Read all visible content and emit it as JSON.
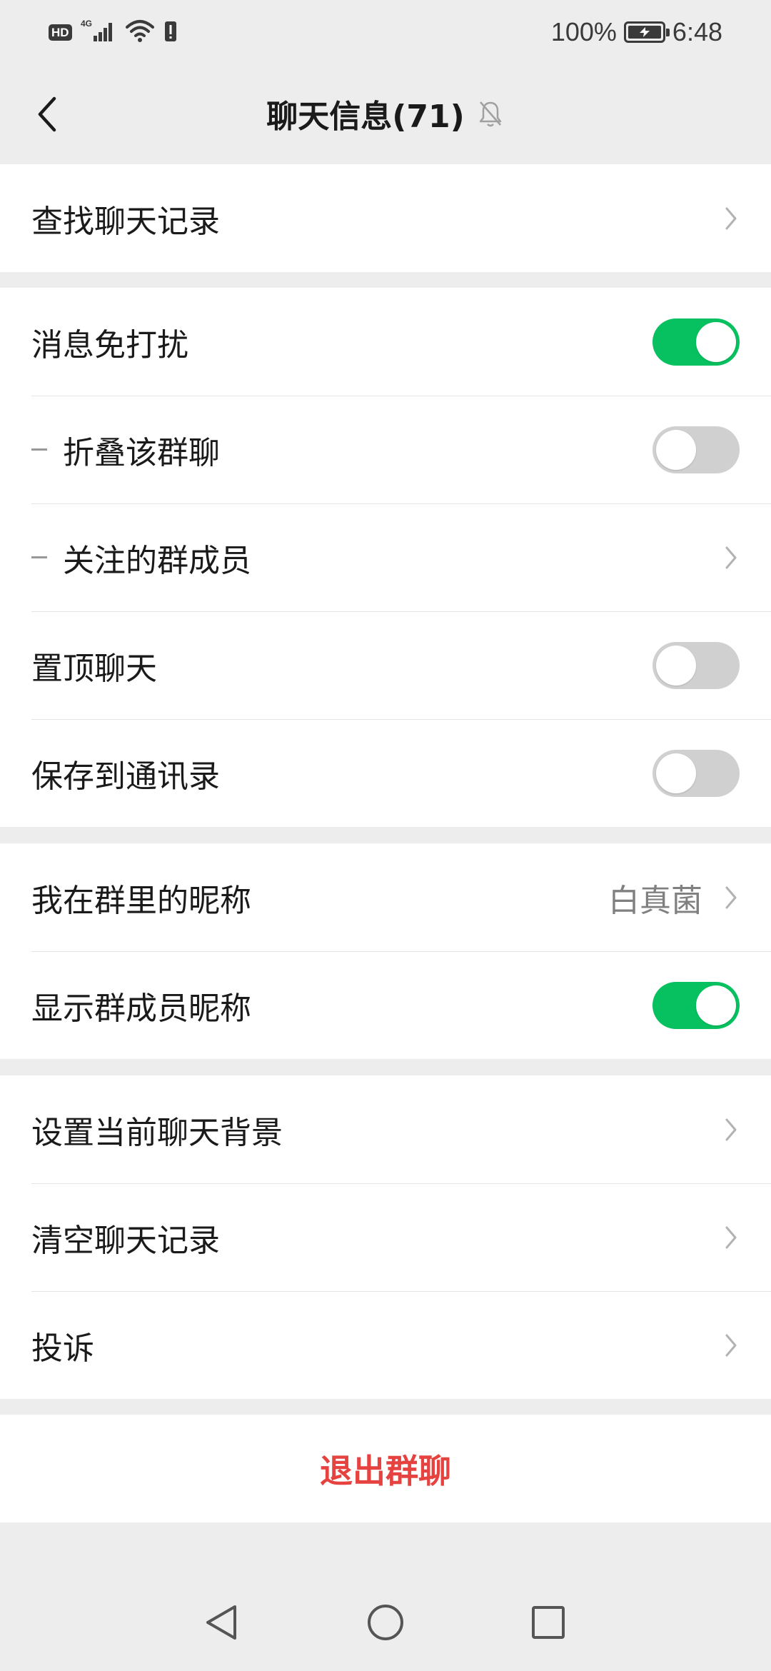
{
  "status_bar": {
    "network_badge": "HD",
    "network_type": "4G",
    "battery_percent": "100%",
    "time": "6:48",
    "icons": [
      "hd-badge",
      "signal-icon",
      "wifi-icon",
      "alert-icon",
      "battery-charging-icon"
    ]
  },
  "header": {
    "title": "聊天信息(71)",
    "back_icon": "back-chevron-icon",
    "mute_indicator_icon": "muted-bell-icon"
  },
  "groups": {
    "search": {
      "find_chat_history": "查找聊天记录"
    },
    "notifications": {
      "mute_messages": {
        "label": "消息免打扰",
        "on": true
      },
      "fold_group": {
        "label": "折叠该群聊",
        "on": false
      },
      "followed_members": {
        "label": "关注的群成员"
      },
      "pin_chat": {
        "label": "置顶聊天",
        "on": false
      },
      "save_to_contacts": {
        "label": "保存到通讯录",
        "on": false
      }
    },
    "nickname": {
      "my_nickname": {
        "label": "我在群里的昵称",
        "value": "白真菌"
      },
      "show_member_nicknames": {
        "label": "显示群成员昵称",
        "on": true
      }
    },
    "misc": {
      "set_background": "设置当前聊天背景",
      "clear_history": "清空聊天记录",
      "report": "投诉"
    },
    "exit": {
      "exit_group": "退出群聊"
    }
  },
  "colors": {
    "accent_green": "#07c160",
    "danger_red": "#e64340",
    "background": "#ededed",
    "toggle_off": "#d0d0d0"
  },
  "nav_bar": {
    "icons": [
      "nav-back-icon",
      "nav-home-icon",
      "nav-recents-icon"
    ]
  }
}
